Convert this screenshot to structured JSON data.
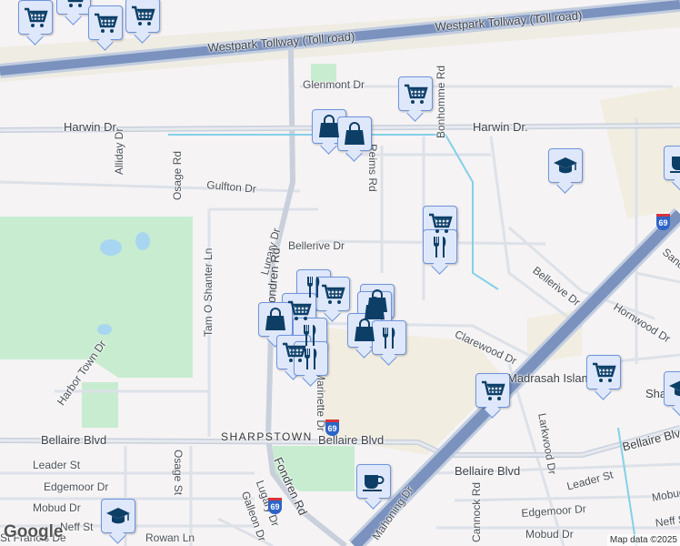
{
  "map": {
    "labels": [
      "Westpark Tollway (Toll road)",
      "Westpark Tollway (Toll road)",
      "Glenmont Dr",
      "Harwin Dr.",
      "Harwin Dr.",
      "Alliday Dr",
      "Osage Rd",
      "Gulfton Dr",
      "Reims Rd",
      "Bonhomme Rd",
      "Bellerive Dr",
      "Bellerive Dr",
      "Lugary Dr",
      "Fondren Rd",
      "Tam O Shanter Ln",
      "Harbor Town Dr",
      "Marinette Dr",
      "Clarewood Dr",
      "Hornwood Dr",
      "Larkwood Dr",
      "Madrasah Islami",
      "Sha",
      "Sand",
      "SHARPSTOWN",
      "Bellaire Blvd",
      "Bellaire Blvd",
      "Bellaire Blvd",
      "Bellaire Blvd",
      "Leader St",
      "Leader St",
      "Osage St",
      "Edgemoor Dr",
      "Edgemoor Dr",
      "Mobud Dr",
      "Mobud Dr",
      "Mobud Dr",
      "Neff St",
      "Neff St",
      "Rowan Ln",
      "Lugary Dr",
      "Galleon Dr",
      "Fondren Rd",
      "Mahoning Dr",
      "Cannock Rd",
      "St Francis De",
      "M",
      "Dr"
    ],
    "highway_shield": "69",
    "marker_types": [
      "shopping-cart",
      "shopping-bag",
      "restaurant",
      "school",
      "coffee"
    ],
    "colors": {
      "marker_fill": "#dfe8fb",
      "marker_border": "#6f94dc",
      "icon": "#0d3f66",
      "park": "#c8ecd0",
      "commercial": "#f1ede0",
      "highway": "#8a9fc4"
    }
  },
  "branding": {
    "logo": "Google",
    "attribution": "Map data ©2025"
  }
}
